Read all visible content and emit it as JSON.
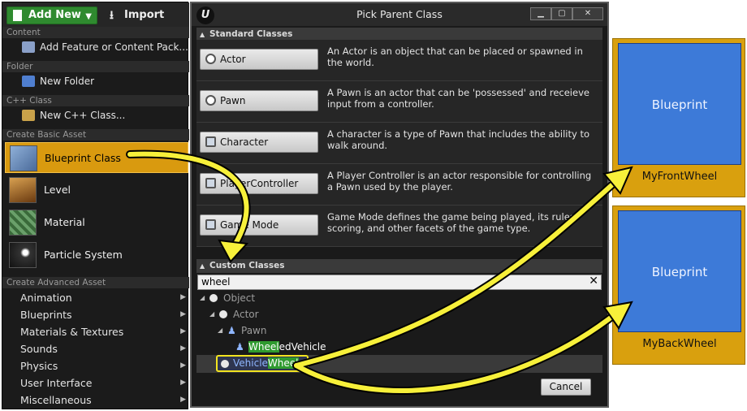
{
  "left_menu": {
    "add_new_label": "Add New",
    "import_label": "Import",
    "sections": {
      "content": "Content",
      "folder": "Folder",
      "cpp": "C++ Class",
      "basic": "Create Basic Asset",
      "advanced": "Create Advanced Asset"
    },
    "add_feature_label": "Add Feature or Content Pack...",
    "new_folder_label": "New Folder",
    "new_cpp_label": "New C++ Class...",
    "basic_assets": [
      "Blueprint Class",
      "Level",
      "Material",
      "Particle System"
    ],
    "advanced_assets": [
      "Animation",
      "Blueprints",
      "Materials & Textures",
      "Sounds",
      "Physics",
      "User Interface",
      "Miscellaneous"
    ]
  },
  "dialog": {
    "title": "Pick Parent Class",
    "standard_header": "Standard Classes",
    "standard_classes": [
      {
        "name": "Actor",
        "description": "An Actor is an object that can be placed or spawned in the world."
      },
      {
        "name": "Pawn",
        "description": "A Pawn is an actor that can be 'possessed' and receieve input from a controller."
      },
      {
        "name": "Character",
        "description": "A character is a type of Pawn that includes the ability to walk around."
      },
      {
        "name": "PlayerController",
        "description": "A Player Controller is an actor responsible for controlling a Pawn used by the player."
      },
      {
        "name": "Game Mode",
        "description": "Game Mode defines the game being played, its rules, scoring, and other facets of the game type."
      }
    ],
    "custom_header": "Custom Classes",
    "search_value": "wheel",
    "tree": {
      "object": "Object",
      "actor": "Actor",
      "pawn": "Pawn",
      "wheeled_vehicle_match": "Wheel",
      "wheeled_vehicle_rest": "edVehicle",
      "vehicle_wheel_prefix": "Vehicle",
      "vehicle_wheel_match": "Wheel"
    },
    "cancel_label": "Cancel"
  },
  "tiles": [
    {
      "face": "Blueprint",
      "name": "MyFrontWheel"
    },
    {
      "face": "Blueprint",
      "name": "MyBackWheel"
    }
  ],
  "colors": {
    "selection_orange": "#d99a0f",
    "add_new_green": "#2f8a2f",
    "arrow_yellow": "#f7f03a",
    "blueprint_blue": "#3d7ad8",
    "search_highlight": "#2f9b2f"
  }
}
